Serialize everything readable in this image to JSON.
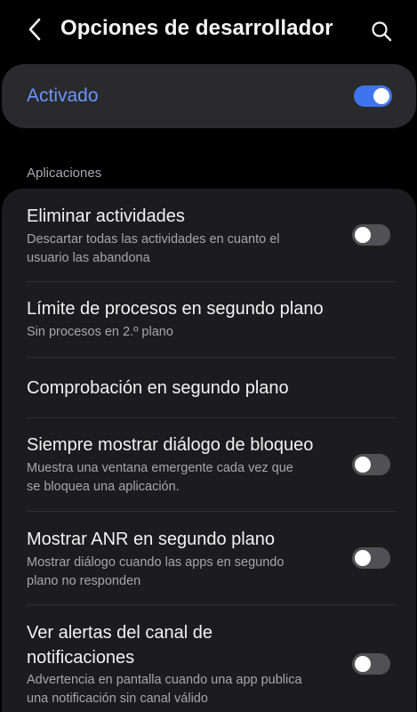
{
  "header": {
    "title": "Opciones de desarrollador",
    "back_icon": "chevron-left-icon",
    "search_icon": "search-icon"
  },
  "master": {
    "label": "Activado",
    "enabled": true,
    "accent_color": "#3e74ee",
    "label_color": "#6a95ff"
  },
  "section": {
    "title": "Aplicaciones"
  },
  "items": [
    {
      "title": "Eliminar actividades",
      "subtitle_line1": "Descartar todas las actividades en cuanto el",
      "subtitle_line2": "usuario las abandona",
      "toggle": "off"
    },
    {
      "title": "Límite de procesos en segundo plano",
      "subtitle_line1": "Sin procesos en 2.º plano"
    },
    {
      "title": "Comprobación en segundo plano"
    },
    {
      "title": "Siempre mostrar diálogo de bloqueo",
      "subtitle_line1": "Muestra una ventana emergente cada vez que",
      "subtitle_line2": "se bloquea una aplicación.",
      "toggle": "off"
    },
    {
      "title": "Mostrar ANR en segundo plano",
      "subtitle_line1": "Mostrar diálogo cuando las apps en segundo",
      "subtitle_line2": "plano no responden",
      "toggle": "off"
    },
    {
      "title_line1": "Ver alertas del canal de",
      "title_line2": "notificaciones",
      "subtitle_line1": "Advertencia en pantalla cuando una app publica",
      "subtitle_line2": "una notificación sin canal válido",
      "toggle": "off"
    }
  ]
}
